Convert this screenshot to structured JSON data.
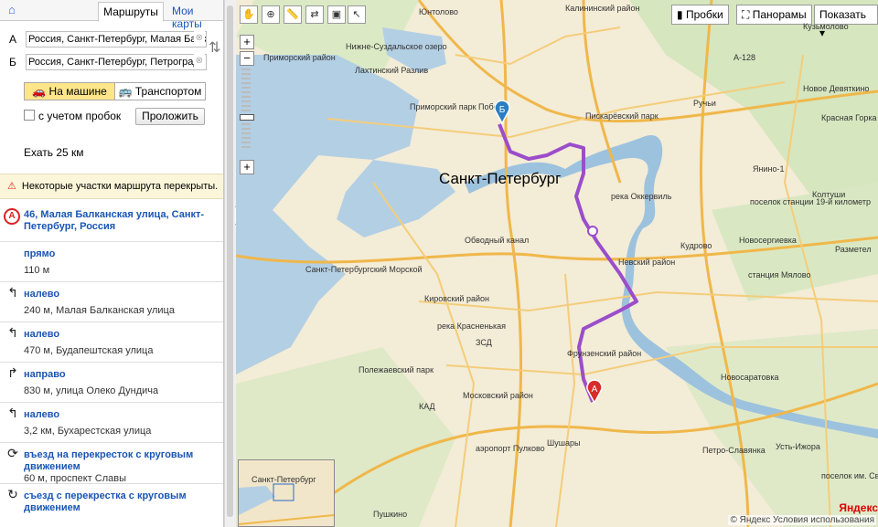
{
  "tabs": {
    "home_icon": "home-icon",
    "routes": "Маршруты",
    "my_maps": "Мои карты"
  },
  "route_form": {
    "from_letter": "А",
    "from_value": "Россия, Санкт-Петербург, Малая Балк",
    "to_letter": "Б",
    "to_value": "Россия, Санкт-Петербург, Петроградс",
    "mode_car": "На машине",
    "mode_transit": "Транспортом",
    "traffic_label": "с учетом пробок",
    "build_button": "Проложить",
    "distance": "Ехать 25 км"
  },
  "warning": "Некоторые участки маршрута перекрыты.",
  "steps": [
    {
      "icon": "start-a-icon",
      "direction": "46, Малая Балканская улица, Санкт-Петербург, Россия",
      "detail": ""
    },
    {
      "icon": "straight-icon",
      "direction": "прямо",
      "detail": "110 м"
    },
    {
      "icon": "turn-left-icon",
      "direction": "налево",
      "detail": "240 м, Малая Балканская улица"
    },
    {
      "icon": "turn-left-icon",
      "direction": "налево",
      "detail": "470 м, Будапештская улица"
    },
    {
      "icon": "turn-right-icon",
      "direction": "направо",
      "detail": "830 м, улица Олеко Дундича"
    },
    {
      "icon": "turn-left-icon",
      "direction": "налево",
      "detail": "3,2 км, Бухарестская улица"
    },
    {
      "icon": "roundabout-enter-icon",
      "direction": "въезд на перекресток с круговым движением",
      "detail": "60 м, проспект Славы"
    },
    {
      "icon": "roundabout-exit-icon",
      "direction": "съезд с перекрестка с круговым движением",
      "detail": ""
    }
  ],
  "map": {
    "buttons": {
      "traffic": "Пробки",
      "panoramas": "Панорамы",
      "show": "Показать"
    },
    "city": "Санкт-Петербург",
    "labels": [
      "Калининский район",
      "Приморский район",
      "Приморский парк Победы",
      "Нижне-Суздальское озеро",
      "Пискарёвский парк",
      "Ручьи",
      "Янино-1",
      "Колтуши",
      "Кудрово",
      "Новосергиевка",
      "Разметел",
      "станция Мялово",
      "Невский район",
      "Кировский район",
      "Обводный канал",
      "река Оккервиль",
      "Фрунзенский район",
      "Московский район",
      "Шушары",
      "Пушкино",
      "Новосаратовка",
      "Полежаевский парк",
      "аэропорт Пулково",
      "Петро-Славянка",
      "Усть-Ижора",
      "поселок им. Свердлов",
      "Красная Горка",
      "Юнтолово",
      "Лахтинский Разлив",
      "река Красненькая",
      "Санкт-Петербургский Морской",
      "ЗСД",
      "КАД",
      "А-128",
      "поселок станции 19-й километр",
      "Кузьмолово",
      "Новое Девяткино",
      "А",
      "Б"
    ],
    "minimap_label": "Санкт-Петербург",
    "brand": "Яндекс",
    "legal": "© Яндекс   Условия использования"
  },
  "colors": {
    "route": "#9b4dca",
    "accent": "#fde58a",
    "link": "#1a55b5"
  }
}
